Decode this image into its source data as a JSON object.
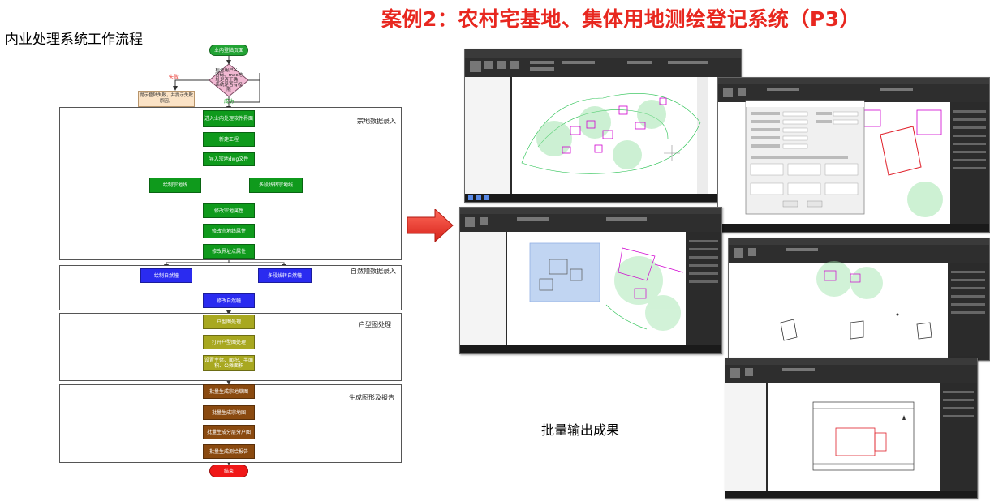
{
  "title": "案例2：农村宅基地、集体用地测绘登记系统（P3）",
  "subtitle": "内业处理系统工作流程",
  "caption": "批量输出成果",
  "flowchart": {
    "start": "业内登陆页面",
    "decision": "检查用户名、密码、mac地址是否正确，系统是否有权限",
    "fail_label": "失败",
    "success_label": "成功",
    "fail_note": "提示登陆失败，并提示失败原因。",
    "end": "结束",
    "sections": [
      {
        "label": "宗地数据录入"
      },
      {
        "label": "自然幢数据录入"
      },
      {
        "label": "户型图处理"
      },
      {
        "label": "生成图形及报告"
      }
    ],
    "nodes": {
      "enter_system": "进入业内处理软件界面",
      "new_project": "新建工程",
      "import_dwg": "导入宗地dwg文件",
      "draw_parcel": "绘制宗地线",
      "polyline_parcel": "多段线转宗地线",
      "edit_parcel_attr": "修改宗地属性",
      "edit_parcel_line_attr": "修改宗地线属性",
      "edit_boundary_attr": "修改界址点属性",
      "draw_building": "绘制自然幢",
      "polyline_building": "多段线转自然幢",
      "edit_building": "修改自然幢",
      "house_plan": "户型图处理",
      "open_house_plan": "打开户型图处理",
      "set_area": "设置主体、面积、半面积、公摊面积",
      "batch_parcel_sketch": "批量生成宗地草图",
      "batch_parcel_map": "批量生成宗地图",
      "batch_floor_plan": "批量生成分层分户图",
      "batch_survey_report": "批量生成测绘报告"
    }
  },
  "screenshots": [
    {
      "name": "cad-parcel-map"
    },
    {
      "name": "cad-attribute-dialog"
    },
    {
      "name": "cad-selection-view"
    },
    {
      "name": "cad-building-outlines"
    },
    {
      "name": "cad-floor-plan-output"
    }
  ],
  "colors": {
    "title": "#e8271f",
    "arrow": "#e8322a",
    "step_green": "#0f9a1c",
    "step_blue": "#2a2bf0",
    "step_olive": "#a8a820",
    "step_brown": "#8a4a10",
    "end_red": "#f01818"
  }
}
